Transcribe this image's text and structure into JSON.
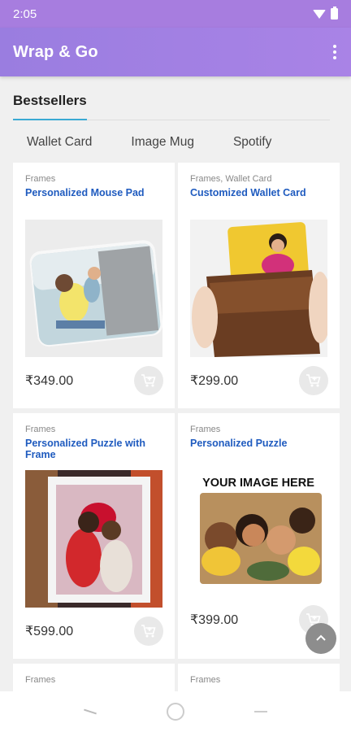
{
  "status": {
    "time": "2:05"
  },
  "app": {
    "title": "Wrap & Go"
  },
  "section": {
    "title": "Bestsellers"
  },
  "tabs": [
    "Wallet Card",
    "Image Mug",
    "Spotify"
  ],
  "products": [
    {
      "category": "Frames",
      "name": "Personalized Mouse Pad",
      "price": "₹349.00",
      "image": "mouse-pad-image"
    },
    {
      "category": "Frames, Wallet Card",
      "name": "Customized Wallet Card",
      "price": "₹299.00",
      "image": "wallet-card-image"
    },
    {
      "category": "Frames",
      "name": "Personalized Puzzle with Frame",
      "price": "₹599.00",
      "image": "puzzle-frame-image"
    },
    {
      "category": "Frames",
      "name": "Personalized Puzzle",
      "price": "₹399.00",
      "image": "puzzle-image",
      "image_caption": "YOUR IMAGE HERE"
    },
    {
      "category": "Frames"
    },
    {
      "category": "Frames"
    }
  ],
  "colors": {
    "app_bar": "#a983e6",
    "status_bar": "#a77ddf",
    "link": "#1f5bbf",
    "tab_underline": "#3aa9d3"
  }
}
